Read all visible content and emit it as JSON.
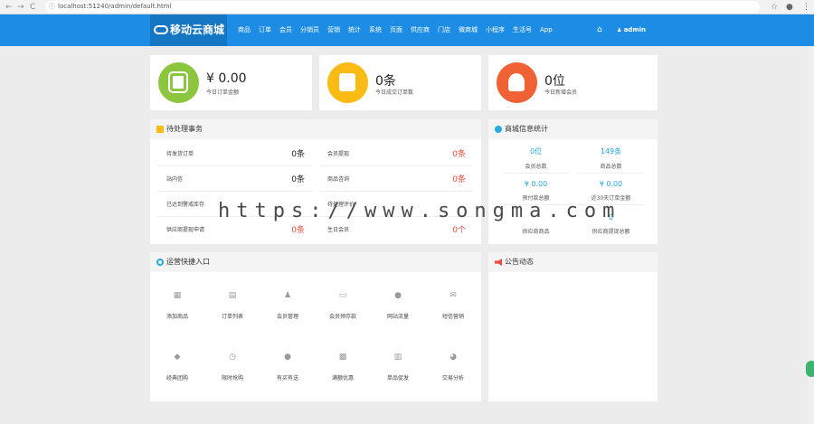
{
  "browser": {
    "back": "←",
    "forward": "→",
    "reload": "C",
    "url": "localhost:51240/admin/default.html",
    "right_icons": [
      "☆",
      "●",
      "⋮"
    ]
  },
  "header": {
    "logo": "移动云商城",
    "menu": [
      "商品",
      "订单",
      "会员",
      "分销员",
      "营销",
      "统计",
      "系统",
      "页面",
      "供应商",
      "门店",
      "微商城",
      "小程序",
      "生活号",
      "App"
    ],
    "home_icon": "⌂",
    "user": "admin",
    "user_icon": "👤"
  },
  "stats": [
    {
      "value": "¥ 0.00",
      "label": "今日订单金额",
      "color": "#8cc63f",
      "icon": "safe-icon"
    },
    {
      "value": "0条",
      "label": "今日成交订单数",
      "color": "#f9bb14",
      "icon": "clipboard-icon"
    },
    {
      "value": "0位",
      "label": "今日新增会员",
      "color": "#f06135",
      "icon": "user-add-icon"
    }
  ],
  "todo": {
    "title": "待处理事务",
    "rows": [
      {
        "left_label": "待发货订单",
        "left_value": "0条",
        "left_red": false,
        "right_label": "会员提现",
        "right_value": "0条",
        "right_red": true
      },
      {
        "left_label": "站内信",
        "left_value": "0条",
        "left_red": false,
        "right_label": "商品咨询",
        "right_value": "0条",
        "right_red": true
      },
      {
        "left_label": "已达到警戒库存",
        "left_value": "",
        "left_red": true,
        "right_label": "待处理评价",
        "right_value": "",
        "right_red": true
      },
      {
        "left_label": "供应商提现申请",
        "left_value": "0条",
        "left_red": true,
        "right_label": "生日会员",
        "right_value": "0个",
        "right_red": true
      }
    ]
  },
  "mall_stats": {
    "title": "商城信息统计",
    "cells": [
      {
        "value": "0位",
        "label": "会员总数"
      },
      {
        "value": "149条",
        "label": "商品总数"
      },
      {
        "value": "¥ 0.00",
        "label": "预付款总额"
      },
      {
        "value": "¥ 0.00",
        "label": "近30天订单金额"
      },
      {
        "value": "",
        "label": "供应商商品"
      },
      {
        "value": "0",
        "label": "供应商提现总额"
      }
    ]
  },
  "quick": {
    "title": "运营快捷入口",
    "items": [
      {
        "label": "添加商品",
        "icon": "▦",
        "name": "add-goods"
      },
      {
        "label": "订单列表",
        "icon": "▤",
        "name": "order-list"
      },
      {
        "label": "会员管理",
        "icon": "♟",
        "name": "member-manage"
      },
      {
        "label": "会员预存款",
        "icon": "▭",
        "name": "member-deposit"
      },
      {
        "label": "网站流量",
        "icon": "●",
        "name": "site-traffic"
      },
      {
        "label": "短信营销",
        "icon": "✉",
        "name": "sms-marketing"
      },
      {
        "label": "经典团购",
        "icon": "◆",
        "name": "group-buy"
      },
      {
        "label": "限时抢购",
        "icon": "◷",
        "name": "flash-sale"
      },
      {
        "label": "有买有送",
        "icon": "●",
        "name": "buy-gift"
      },
      {
        "label": "满额优惠",
        "icon": "▩",
        "name": "full-discount"
      },
      {
        "label": "单品促发",
        "icon": "▥",
        "name": "single-promo"
      },
      {
        "label": "交易分析",
        "icon": "◕",
        "name": "trade-analysis"
      }
    ]
  },
  "notice": {
    "title": "公告动态"
  },
  "watermark": "https://www.songma.com"
}
